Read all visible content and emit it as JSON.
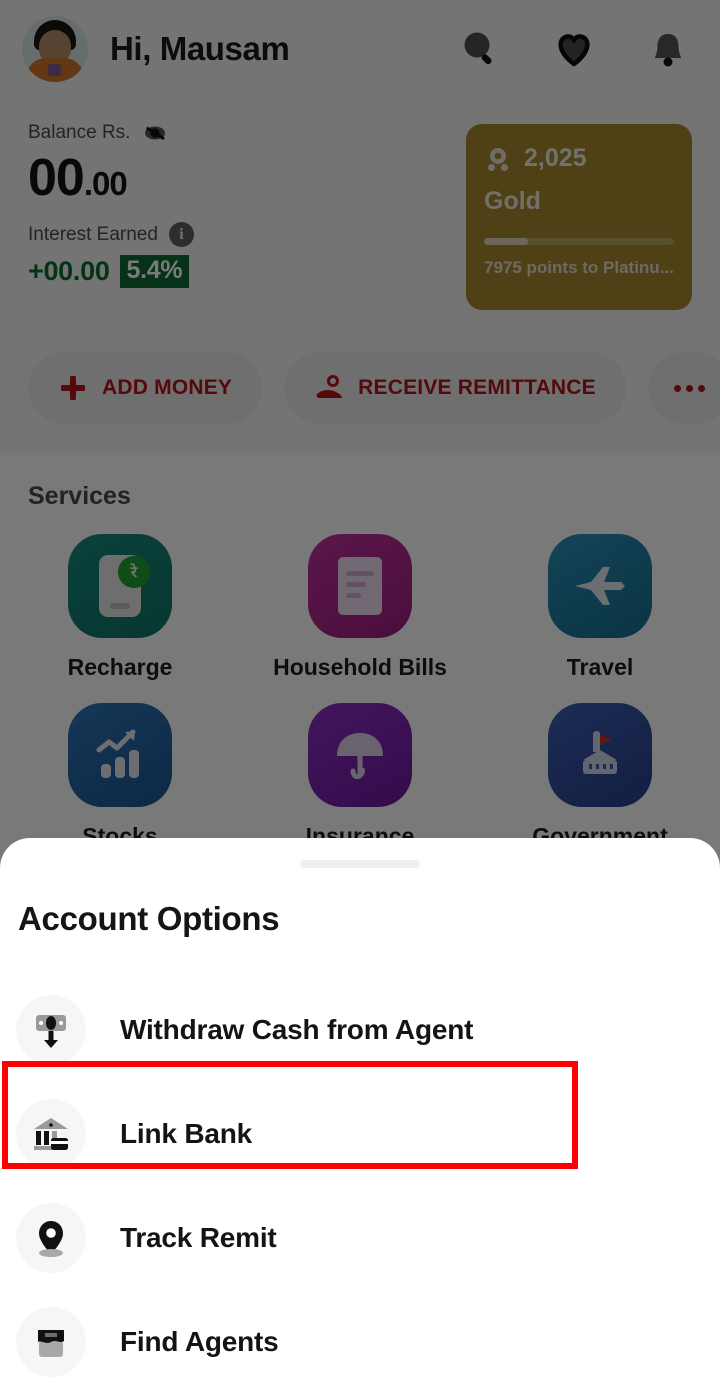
{
  "header": {
    "greeting": "Hi, Mausam",
    "avatar_name": "user-avatar",
    "icons": [
      {
        "name": "search-icon",
        "label": "Search"
      },
      {
        "name": "heart-icon",
        "label": "Favorites"
      },
      {
        "name": "bell-icon",
        "label": "Notifications"
      }
    ]
  },
  "balance": {
    "label": "Balance Rs.",
    "visibility_icon": "eye-off-icon",
    "amount_whole": "00",
    "amount_cents": ".00",
    "interest_label": "Interest Earned",
    "interest_info_icon": "i",
    "interest_amount": "+00.00",
    "interest_rate": "5.4%",
    "positive_color": "#0d6b34"
  },
  "rewards": {
    "points": "2,025",
    "tier": "Gold",
    "progress_percent": 23,
    "footnote": "7975 points to Platinu...",
    "card_color": "#a5862f"
  },
  "actions": [
    {
      "name": "add-money-button",
      "label": "ADD MONEY",
      "icon": "plus-icon"
    },
    {
      "name": "receive-remittance-button",
      "label": "RECEIVE REMITTANCE",
      "icon": "hand-money-icon"
    },
    {
      "name": "more-actions-button",
      "label": "",
      "icon": "ellipsis-icon"
    }
  ],
  "action_color": "#b2131b",
  "services": {
    "title": "Services",
    "items": [
      {
        "label": "Recharge",
        "icon": "phone-recharge-icon",
        "color": "#14857a"
      },
      {
        "label": "Household Bills",
        "icon": "bill-receipt-icon",
        "color": "#b0228c"
      },
      {
        "label": "Travel",
        "icon": "airplane-icon",
        "color": "#1c7fa4"
      },
      {
        "label": "Stocks",
        "icon": "chart-growth-icon",
        "color": "#21609e"
      },
      {
        "label": "Insurance",
        "icon": "umbrella-icon",
        "color": "#7a21b0"
      },
      {
        "label": "Government",
        "icon": "government-building-icon",
        "color": "#2f4f9e"
      }
    ]
  },
  "sheet": {
    "title": "Account Options",
    "handle": "drag-handle",
    "options": [
      {
        "label": "Withdraw Cash from Agent",
        "icon": "withdraw-cash-icon",
        "highlighted": false
      },
      {
        "label": "Link Bank",
        "icon": "bank-icon",
        "highlighted": true
      },
      {
        "label": "Track Remit",
        "icon": "location-pin-icon",
        "highlighted": false
      },
      {
        "label": "Find Agents",
        "icon": "storefront-icon",
        "highlighted": false
      }
    ]
  },
  "highlight": {
    "target": "Link Bank",
    "color": "#fd0000"
  }
}
